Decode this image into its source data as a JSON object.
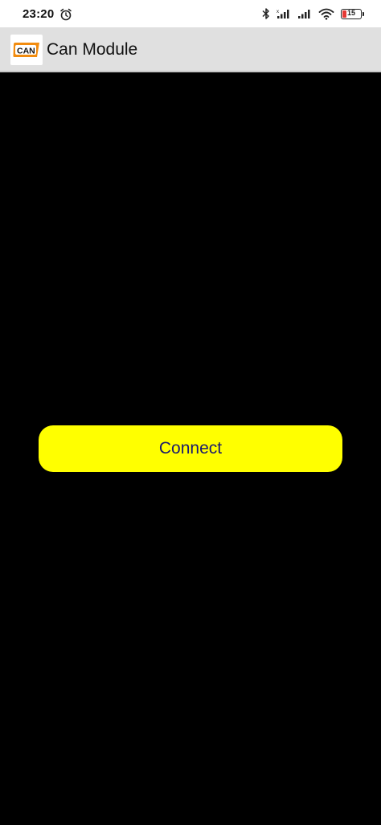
{
  "status_bar": {
    "time": "23:20",
    "alarm_icon": "alarm-clock-icon",
    "bluetooth_icon": "bluetooth-icon",
    "signal_icon": "cell-signal-icon",
    "wifi_icon": "wifi-icon",
    "battery_level": "15",
    "battery_color": "#e53935"
  },
  "app_bar": {
    "logo_text": "CAN",
    "title": "Can Module",
    "background": "#e0e0e0"
  },
  "main": {
    "background": "#000000",
    "connect_button": {
      "label": "Connect",
      "background": "#ffff00",
      "text_color": "#1a1a6e"
    }
  }
}
